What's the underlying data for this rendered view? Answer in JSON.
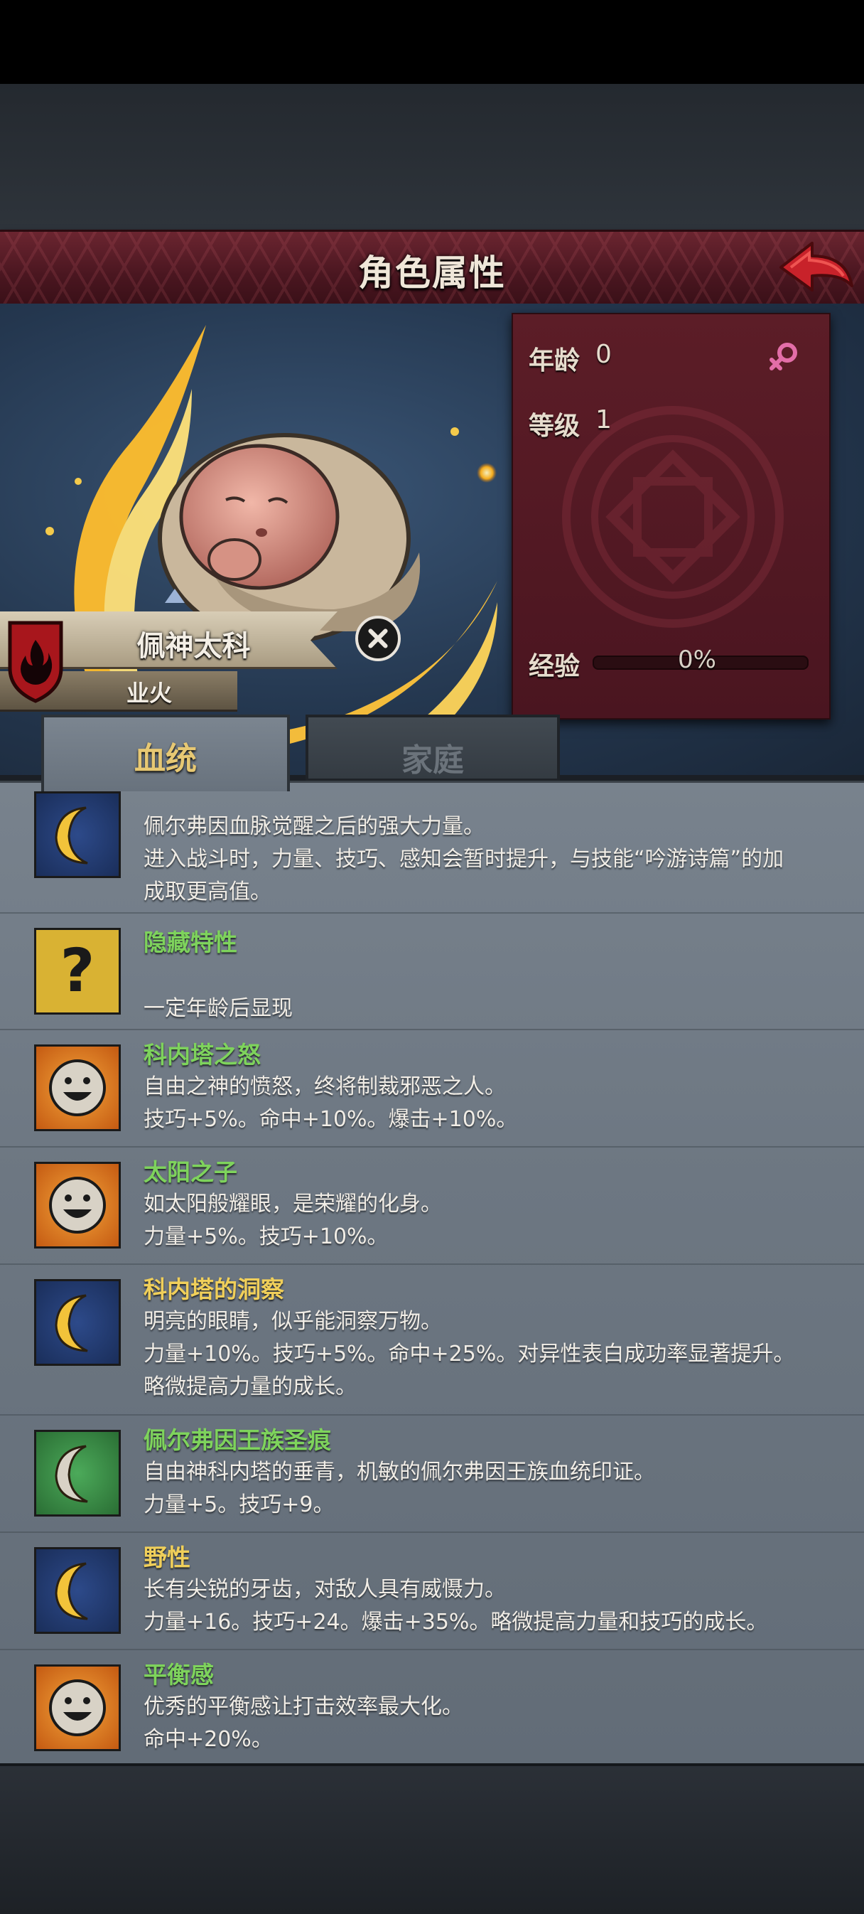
{
  "header": {
    "title": "角色属性"
  },
  "stats": {
    "age_label": "年龄",
    "age_value": "0",
    "level_label": "等级",
    "level_value": "1",
    "exp_label": "经验",
    "exp_value": "0%",
    "exp_progress": 0,
    "gender": "female"
  },
  "character": {
    "name": "佩神太科",
    "title": "业火"
  },
  "tabs": {
    "active": "血统",
    "inactive": "家庭"
  },
  "colors": {
    "trait_green": "#7ed35c",
    "trait_yellow": "#f0cf5a",
    "header_red": "#5a1c26"
  },
  "traits": [
    {
      "icon": "moon-icon",
      "name": "",
      "lines": [
        "佩尔弗因血脉觉醒之后的强大力量。",
        "进入战斗时，力量、技巧、感知会暂时提升，与技能“吟游诗篇”的加",
        "成取更高值。"
      ]
    },
    {
      "icon": "question-mark-icon",
      "name": "隐藏特性",
      "lines": [
        "",
        "一定年龄后显现"
      ]
    },
    {
      "icon": "smiley-icon",
      "name": "科内塔之怒",
      "lines": [
        "自由之神的愤怒，终将制裁邪恶之人。",
        "技巧+5%。命中+10%。爆击+10%。"
      ]
    },
    {
      "icon": "smiley-icon",
      "name": "太阳之子",
      "lines": [
        "如太阳般耀眼，是荣耀的化身。",
        "力量+5%。技巧+10%。"
      ]
    },
    {
      "icon": "moon-icon",
      "name": "科内塔的洞察",
      "lines": [
        "明亮的眼睛，似乎能洞察万物。",
        "力量+10%。技巧+5%。命中+25%。对异性表白成功率显著提升。",
        "略微提高力量的成长。"
      ]
    },
    {
      "icon": "moon-icon",
      "name": "佩尔弗因王族圣痕",
      "lines": [
        "自由神科内塔的垂青，机敏的佩尔弗因王族血统印证。",
        "力量+5。技巧+9。"
      ]
    },
    {
      "icon": "moon-icon",
      "name": "野性",
      "lines": [
        "长有尖锐的牙齿，对敌人具有威慑力。",
        "力量+16。技巧+24。爆击+35%。略微提高力量和技巧的成长。"
      ]
    },
    {
      "icon": "smiley-icon",
      "name": "平衡感",
      "lines": [
        "优秀的平衡感让打击效率最大化。",
        "命中+20%。"
      ]
    }
  ]
}
